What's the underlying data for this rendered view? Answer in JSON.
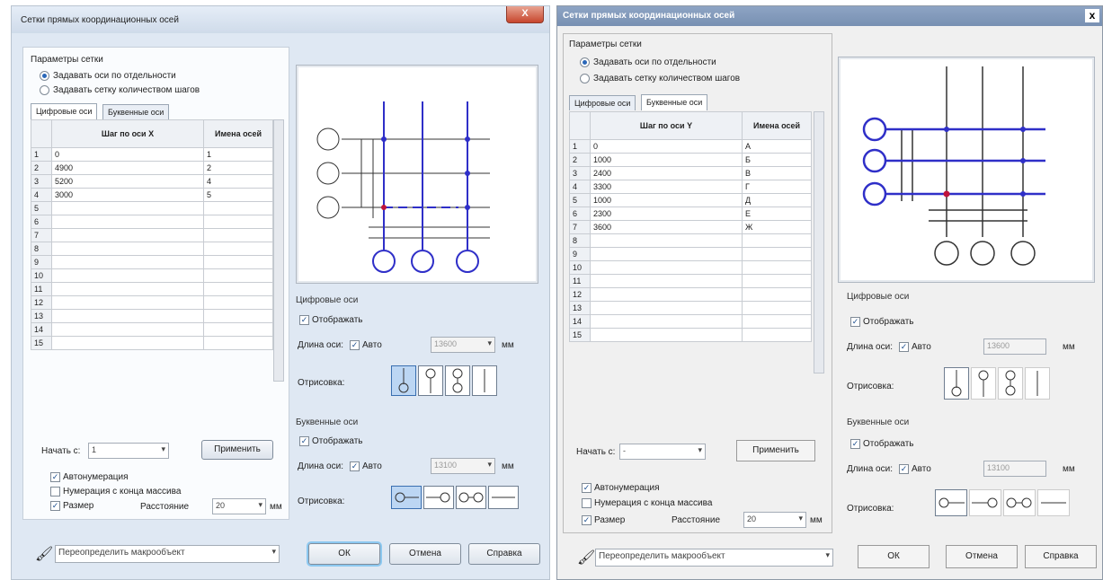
{
  "dialog1": {
    "title": "Сетки прямых координационных осей",
    "close": "X",
    "params_group": "Параметры сетки",
    "radio1": "Задавать оси по отдельности",
    "radio2": "Задавать сетку количеством шагов",
    "tab_digital": "Цифровые оси",
    "tab_letter": "Буквенные оси",
    "col_step": "Шаг по оси X",
    "col_names": "Имена осей",
    "rows": [
      {
        "n": "1",
        "step": "0",
        "name": "1"
      },
      {
        "n": "2",
        "step": "4900",
        "name": "2"
      },
      {
        "n": "3",
        "step": "5200",
        "name": "4"
      },
      {
        "n": "4",
        "step": "3000",
        "name": "5"
      },
      {
        "n": "5",
        "step": "",
        "name": ""
      },
      {
        "n": "6",
        "step": "",
        "name": ""
      },
      {
        "n": "7",
        "step": "",
        "name": ""
      },
      {
        "n": "8",
        "step": "",
        "name": ""
      },
      {
        "n": "9",
        "step": "",
        "name": ""
      },
      {
        "n": "10",
        "step": "",
        "name": ""
      },
      {
        "n": "11",
        "step": "",
        "name": ""
      },
      {
        "n": "12",
        "step": "",
        "name": ""
      },
      {
        "n": "13",
        "step": "",
        "name": ""
      },
      {
        "n": "14",
        "step": "",
        "name": ""
      },
      {
        "n": "15",
        "step": "",
        "name": ""
      }
    ],
    "start_label": "Начать с:",
    "start_value": "1",
    "apply": "Применить",
    "autonum": "Автонумерация",
    "from_end": "Нумерация с конца массива",
    "size": "Размер",
    "distance_label": "Расстояние",
    "distance_value": "20",
    "distance_unit": "мм",
    "digital_group": "Цифровые оси",
    "show": "Отображать",
    "axis_len_label": "Длина оси:",
    "auto": "Авто",
    "digital_len": "13600",
    "unit": "мм",
    "drawing_label": "Отрисовка:",
    "letter_group": "Буквенные оси",
    "letter_len": "13100",
    "macro": "Переопределить макрообъект",
    "ok": "ОК",
    "cancel": "Отмена",
    "help": "Справка"
  },
  "dialog2": {
    "title": "Сетки прямых координационных осей",
    "close": "x",
    "params_group": "Параметры сетки",
    "radio1": "Задавать оси по отдельности",
    "radio2": "Задавать сетку количеством шагов",
    "tab_digital": "Цифровые оси",
    "tab_letter": "Буквенные оси",
    "col_step": "Шаг по оси Y",
    "col_names": "Имена осей",
    "rows": [
      {
        "n": "1",
        "step": "0",
        "name": "А"
      },
      {
        "n": "2",
        "step": "1000",
        "name": "Б"
      },
      {
        "n": "3",
        "step": "2400",
        "name": "В"
      },
      {
        "n": "4",
        "step": "3300",
        "name": "Г"
      },
      {
        "n": "5",
        "step": "1000",
        "name": "Д"
      },
      {
        "n": "6",
        "step": "2300",
        "name": "Е"
      },
      {
        "n": "7",
        "step": "3600",
        "name": "Ж"
      },
      {
        "n": "8",
        "step": "",
        "name": ""
      },
      {
        "n": "9",
        "step": "",
        "name": ""
      },
      {
        "n": "10",
        "step": "",
        "name": ""
      },
      {
        "n": "11",
        "step": "",
        "name": ""
      },
      {
        "n": "12",
        "step": "",
        "name": ""
      },
      {
        "n": "13",
        "step": "",
        "name": ""
      },
      {
        "n": "14",
        "step": "",
        "name": ""
      },
      {
        "n": "15",
        "step": "",
        "name": ""
      }
    ],
    "start_label": "Начать с:",
    "start_value": "-",
    "apply": "Применить",
    "autonum": "Автонумерация",
    "from_end": "Нумерация с конца массива",
    "size": "Размер",
    "distance_label": "Расстояние",
    "distance_value": "20",
    "distance_unit": "мм",
    "digital_group": "Цифровые оси",
    "show": "Отображать",
    "axis_len_label": "Длина оси:",
    "auto": "Авто",
    "digital_len": "13600",
    "unit": "мм",
    "drawing_label": "Отрисовка:",
    "letter_group": "Буквенные оси",
    "letter_len": "13100",
    "macro": "Переопределить макрообъект",
    "ok": "ОК",
    "cancel": "Отмена",
    "help": "Справка"
  }
}
